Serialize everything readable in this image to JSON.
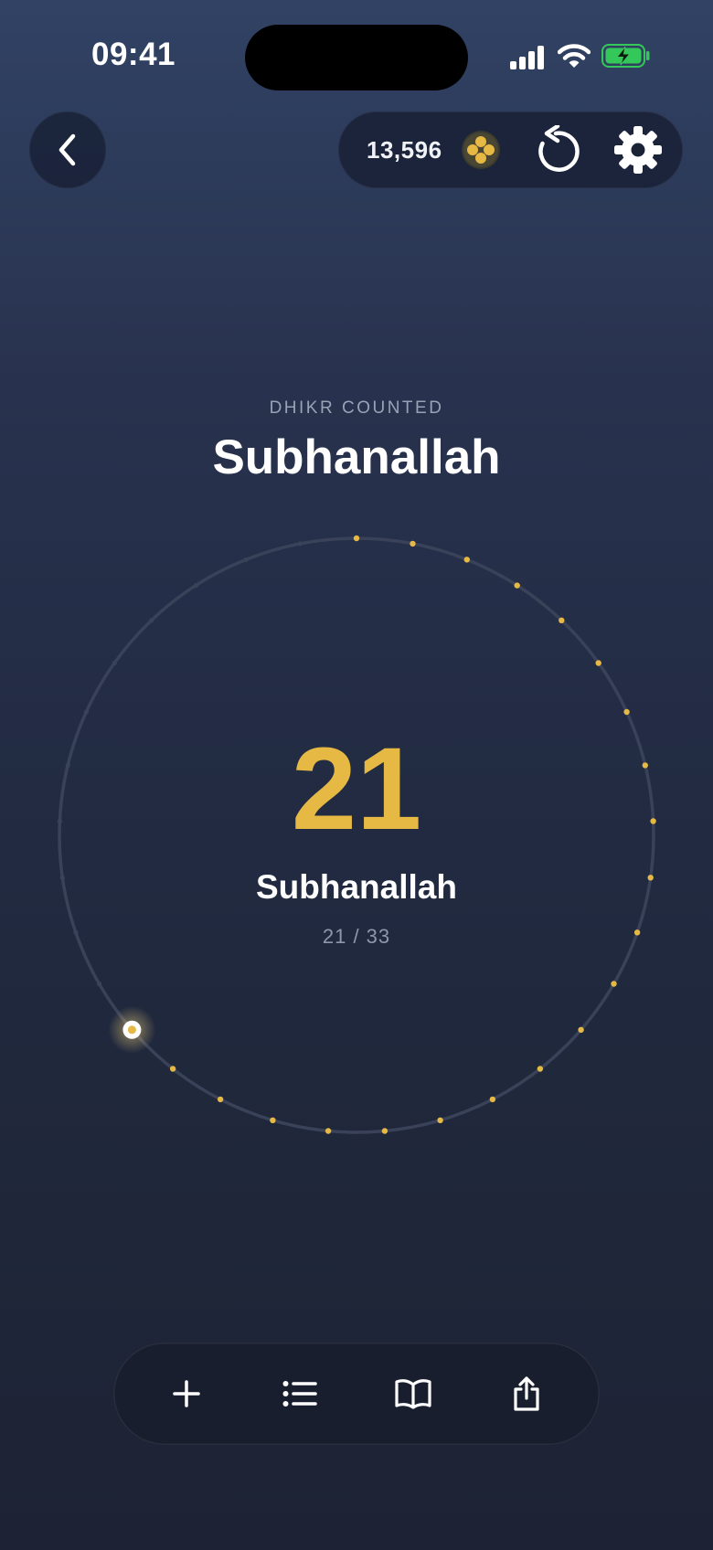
{
  "status_bar": {
    "time": "09:41"
  },
  "header": {
    "coins": "13,596"
  },
  "dhikr": {
    "caption": "DHIKR COUNTED",
    "title": "Subhanallah",
    "count": "21",
    "label": "Subhanallah",
    "progress_text": "21 / 33",
    "current": 21,
    "target": 33
  },
  "colors": {
    "accent_gold": "#e6b844",
    "background_top": "#314264",
    "background_bottom": "#1d2334",
    "ring_track": "#3a4259"
  },
  "icons": {
    "back": "chevron-left-icon",
    "coin": "coin-icon",
    "reset": "reset-icon",
    "settings": "gear-icon",
    "add": "plus-icon",
    "list": "list-icon",
    "book": "book-icon",
    "share": "share-icon"
  }
}
